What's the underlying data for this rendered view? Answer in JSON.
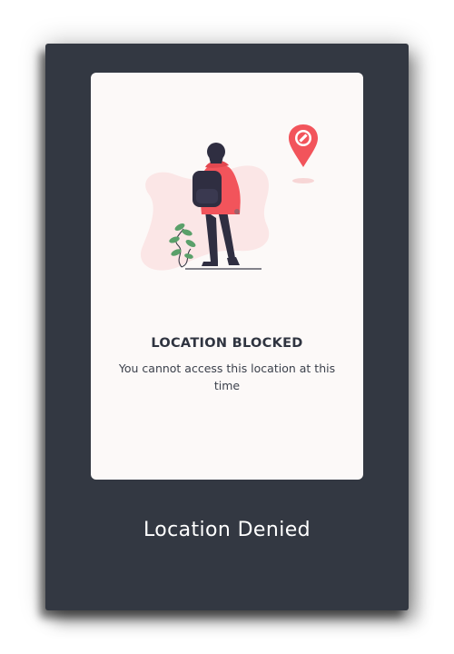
{
  "card": {
    "title": "LOCATION BLOCKED",
    "message": "You cannot access this location at this time"
  },
  "caption": "Location Denied",
  "colors": {
    "panel": "#333842",
    "card": "#fcf9f8",
    "accent": "#f2545b",
    "blob": "#fbe6e6",
    "plant": "#5aa06a",
    "figure_dark": "#2f2e41"
  },
  "icons": [
    "blocked-location-pin-icon",
    "plant-icon"
  ]
}
